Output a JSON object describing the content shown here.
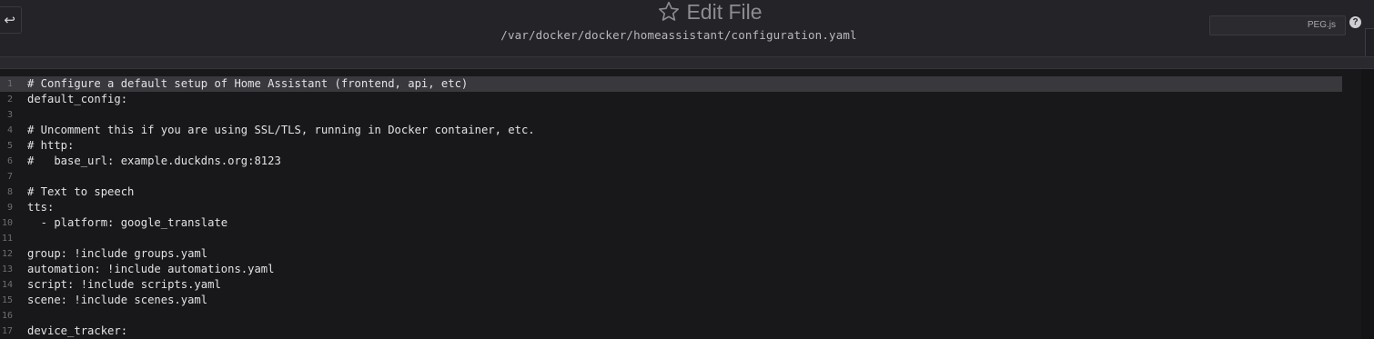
{
  "header": {
    "title": "Edit File",
    "path": "/var/docker/docker/homeassistant/configuration.yaml",
    "back_symbol": "↩",
    "mode_label": "PEG.js",
    "help_symbol": "?"
  },
  "colors": {
    "background": "#242428",
    "editor_background": "#18181b",
    "active_line": "#38383d",
    "text": "#e3e3e6",
    "line_numbers": "#6e6e73"
  },
  "editor": {
    "lines": [
      {
        "num": "1",
        "text": "# Configure a default setup of Home Assistant (frontend, api, etc)"
      },
      {
        "num": "2",
        "text": "default_config:"
      },
      {
        "num": "3",
        "text": ""
      },
      {
        "num": "4",
        "text": "# Uncomment this if you are using SSL/TLS, running in Docker container, etc."
      },
      {
        "num": "5",
        "text": "# http:"
      },
      {
        "num": "6",
        "text": "#   base_url: example.duckdns.org:8123"
      },
      {
        "num": "7",
        "text": ""
      },
      {
        "num": "8",
        "text": "# Text to speech"
      },
      {
        "num": "9",
        "text": "tts:"
      },
      {
        "num": "10",
        "text": "  - platform: google_translate"
      },
      {
        "num": "11",
        "text": ""
      },
      {
        "num": "12",
        "text": "group: !include groups.yaml"
      },
      {
        "num": "13",
        "text": "automation: !include automations.yaml"
      },
      {
        "num": "14",
        "text": "script: !include scripts.yaml"
      },
      {
        "num": "15",
        "text": "scene: !include scenes.yaml"
      },
      {
        "num": "16",
        "text": ""
      },
      {
        "num": "17",
        "text": "device_tracker:"
      }
    ]
  }
}
